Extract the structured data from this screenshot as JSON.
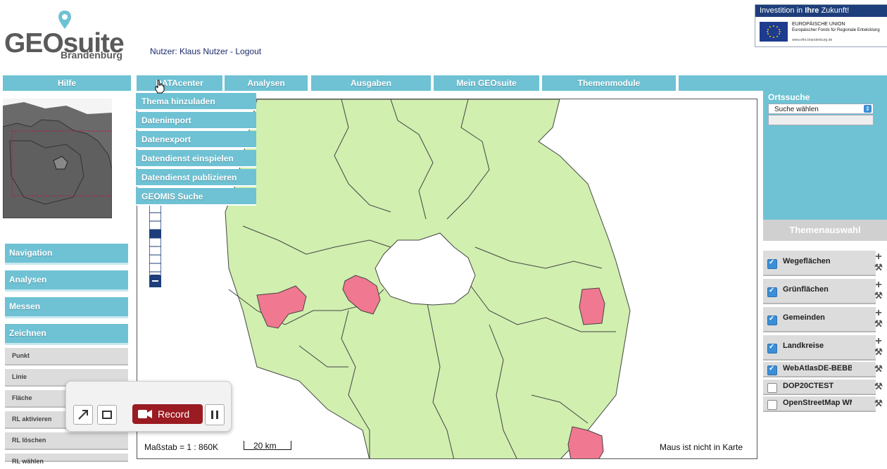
{
  "header": {
    "logo_main": "GEOsuite",
    "logo_sub": "Brandenburg",
    "user_line": "Nutzer: Klaus Nutzer - Logout",
    "eu_banner": {
      "headline_prefix": "Investition in ",
      "headline_bold": "Ihre",
      "headline_suffix": " Zukunft!",
      "line1": "EUROPÄISCHE UNION",
      "line2": "Europäischer Fonds für Regionale Entwicklung",
      "line3": "www.efre.brandenburg.de"
    }
  },
  "nav": {
    "items": [
      "Hilfe",
      "DATAcenter",
      "Analysen",
      "Ausgaben",
      "Mein GEOsuite",
      "Themenmodule"
    ]
  },
  "datacenter_menu": {
    "items": [
      "Thema hinzuladen",
      "Datenimport",
      "Datenexport",
      "Datendienst einspielen",
      "Datendienst publizieren",
      "GEOMIS Suche"
    ]
  },
  "left_panel": {
    "sections": [
      "Navigation",
      "Analysen",
      "Messen",
      "Zeichnen"
    ],
    "draw_tools": [
      "Punkt",
      "Linie",
      "Fläche",
      "RL aktivieren",
      "RL löschen",
      "RL wählen"
    ]
  },
  "map": {
    "scale_label": "Maßstab = 1 : 860K",
    "scale_bar_label": "20 km",
    "mouse_status": "Maus ist nicht in Karte",
    "colors": {
      "region_fill": "#d1efaf",
      "highlight_fill": "#f07890",
      "border": "#444444"
    }
  },
  "recorder": {
    "record_label": "Record"
  },
  "right_panel": {
    "ortssuche_title": "Ortssuche",
    "search_select_value": "Suche wählen",
    "themen_title": "Themenauswahl",
    "layers": [
      {
        "label": "Wegeflächen",
        "checked": true
      },
      {
        "label": "Grünflächen",
        "checked": true
      },
      {
        "label": "Gemeinden",
        "checked": true
      },
      {
        "label": "Landkreise",
        "checked": true
      },
      {
        "label": "WebAtlasDE-BEBB",
        "checked": true
      },
      {
        "label": "DOP20CTEST",
        "checked": false
      },
      {
        "label": "OpenStreetMap WMS",
        "checked": false
      }
    ]
  },
  "accent_color": "#6ec2d4"
}
